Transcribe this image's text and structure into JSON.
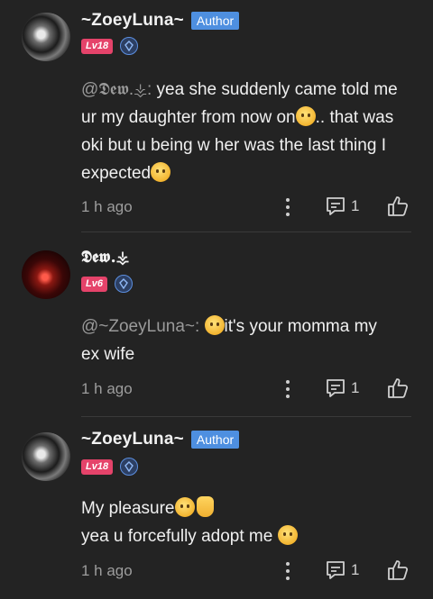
{
  "comments": [
    {
      "username": "~ZoeyLuna~",
      "author_badge": "Author",
      "level": "Lv18",
      "mention": "@𝕯𝖊𝖜.⚶:",
      "text_a": " yea she suddenly came told me ur my daughter from now on",
      "text_b": ".. that was oki but u being w her was the last thing I expected",
      "time": "1 h ago",
      "replies": "1"
    },
    {
      "username": "𝕯𝖊𝖜.⚶",
      "level": "Lv6",
      "mention": "@~ZoeyLuna~:",
      "text_a": "it's your momma my ex wife",
      "time": "1 h ago",
      "replies": "1"
    },
    {
      "username": "~ZoeyLuna~",
      "author_badge": "Author",
      "level": "Lv18",
      "line1": "My pleasure",
      "line2": "yea u forcefully adopt me",
      "time": "1 h ago",
      "replies": "1"
    }
  ],
  "colors": {
    "background": "#232323",
    "author_badge": "#4e8fe0",
    "level_badge": "#e5436a",
    "muted_text": "#9d9d9d"
  },
  "icons": [
    "avatar",
    "diamond-icon",
    "more-icon",
    "reply-icon",
    "like-icon",
    "emoji"
  ]
}
